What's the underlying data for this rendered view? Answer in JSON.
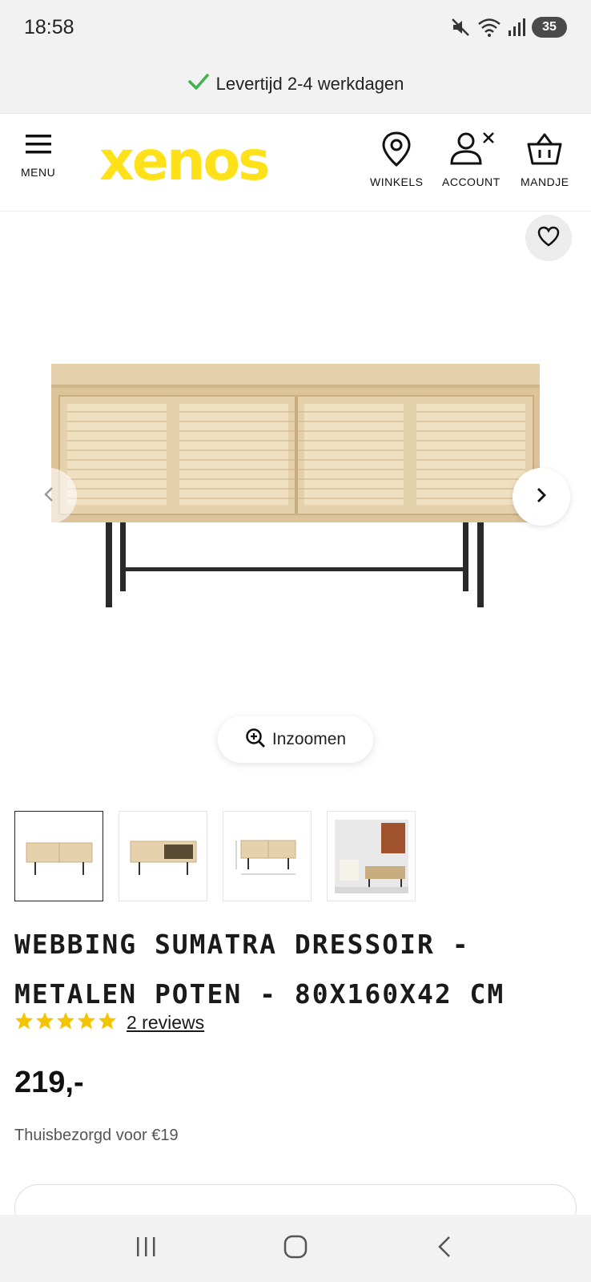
{
  "status_bar": {
    "time": "18:58",
    "battery": "35",
    "icons": [
      "mute-icon",
      "wifi-icon",
      "signal-icon",
      "battery-icon"
    ]
  },
  "banner": {
    "text": "Levertijd 2-4 werkdagen",
    "icon": "check-icon",
    "check_color": "#3cb54a"
  },
  "header": {
    "menu_label": "MENU",
    "logo_text": "xenos",
    "logo_color": "#ffe11a",
    "stores_label": "WINKELS",
    "account_label": "ACCOUNT",
    "cart_label": "MANDJE"
  },
  "gallery": {
    "zoom_label": "Inzoomen",
    "current_image": 1,
    "thumbnail_count": 4
  },
  "product": {
    "title": "WEBBING SUMATRA DRESSOIR - METALEN POTEN - 80X160X42 CM",
    "rating": 5,
    "reviews_label": "2 reviews",
    "price": "219,-",
    "shipping": "Thuisbezorgd voor €19"
  },
  "colors": {
    "star": "#f5c400",
    "wood": "#e3cda8",
    "rattan": "#eedcbc",
    "metal": "#2a2a2a"
  }
}
